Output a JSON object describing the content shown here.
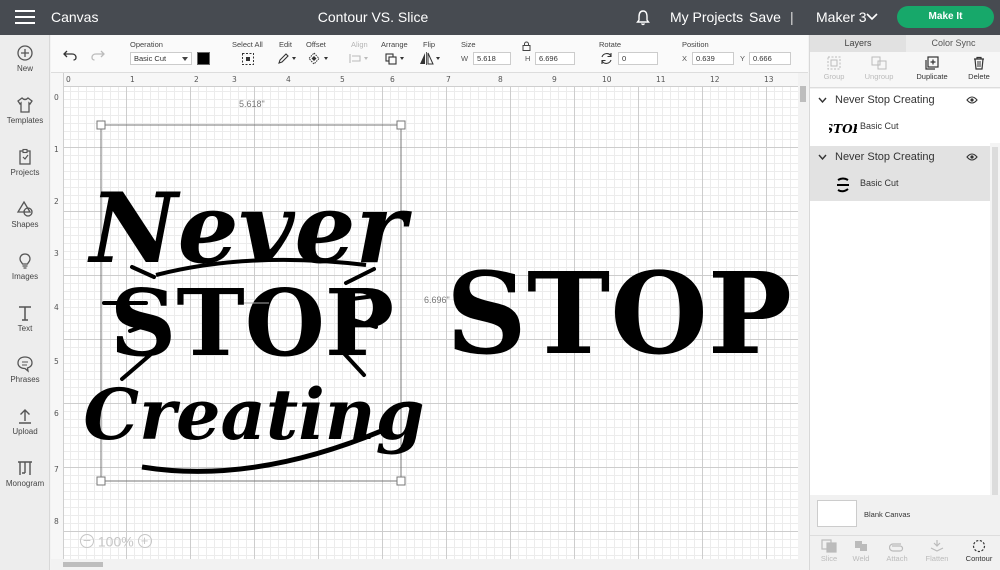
{
  "topbar": {
    "app_name": "Canvas",
    "doc_title": "Contour VS. Slice",
    "my_projects": "My Projects",
    "save": "Save",
    "separator": "|",
    "machine": "Maker 3",
    "make_it": "Make It",
    "make_it_color": "#17a86a"
  },
  "sidebar": {
    "items": [
      {
        "label": "New",
        "icon": "plus-circle-icon"
      },
      {
        "label": "Templates",
        "icon": "shirt-icon"
      },
      {
        "label": "Projects",
        "icon": "clipboard-icon"
      },
      {
        "label": "Shapes",
        "icon": "shapes-icon"
      },
      {
        "label": "Images",
        "icon": "lightbulb-icon"
      },
      {
        "label": "Text",
        "icon": "text-icon"
      },
      {
        "label": "Phrases",
        "icon": "speech-bubble-icon"
      },
      {
        "label": "Upload",
        "icon": "upload-icon"
      },
      {
        "label": "Monogram",
        "icon": "monogram-icon"
      }
    ]
  },
  "toolbar": {
    "operation_label": "Operation",
    "operation_value": "Basic Cut",
    "select_all": "Select All",
    "edit": "Edit",
    "offset": "Offset",
    "align": "Align",
    "arrange": "Arrange",
    "flip": "Flip",
    "size_label": "Size",
    "w_label": "W",
    "w_value": "5.618",
    "h_label": "H",
    "h_value": "6.696",
    "rotate_label": "Rotate",
    "rotate_value": "0",
    "position_label": "Position",
    "x_label": "X",
    "x_value": "0.639",
    "y_label": "Y",
    "y_value": "0.666"
  },
  "ruler": {
    "top": [
      "0",
      "1",
      "2",
      "3",
      "4",
      "5",
      "6",
      "7",
      "8",
      "9",
      "10",
      "11",
      "12",
      "13"
    ],
    "left": [
      "0",
      "1",
      "2",
      "3",
      "4",
      "5",
      "6",
      "7",
      "8"
    ]
  },
  "canvas": {
    "width_dim": "5.618\"",
    "height_dim": "6.696\"",
    "design_lines": [
      "Never",
      "STOP",
      "Creating"
    ],
    "stop_text": "STOP",
    "zoom": "100%"
  },
  "panel": {
    "tab_layers": "Layers",
    "tab_color_sync": "Color Sync",
    "actions": [
      {
        "label": "Group",
        "enabled": false
      },
      {
        "label": "Ungroup",
        "enabled": false
      },
      {
        "label": "Duplicate",
        "enabled": true
      },
      {
        "label": "Delete",
        "enabled": true
      }
    ],
    "groups": [
      {
        "title": "Never Stop Creating",
        "layer": "Basic Cut",
        "thumb": "STOP"
      },
      {
        "title": "Never Stop Creating",
        "layer": "Basic Cut",
        "thumb": "Never Stop Creating"
      }
    ],
    "blank_canvas": "Blank Canvas",
    "bottom_actions": [
      {
        "label": "Slice",
        "enabled": false
      },
      {
        "label": "Weld",
        "enabled": false
      },
      {
        "label": "Attach",
        "enabled": false
      },
      {
        "label": "Flatten",
        "enabled": false
      },
      {
        "label": "Contour",
        "enabled": true
      }
    ]
  }
}
